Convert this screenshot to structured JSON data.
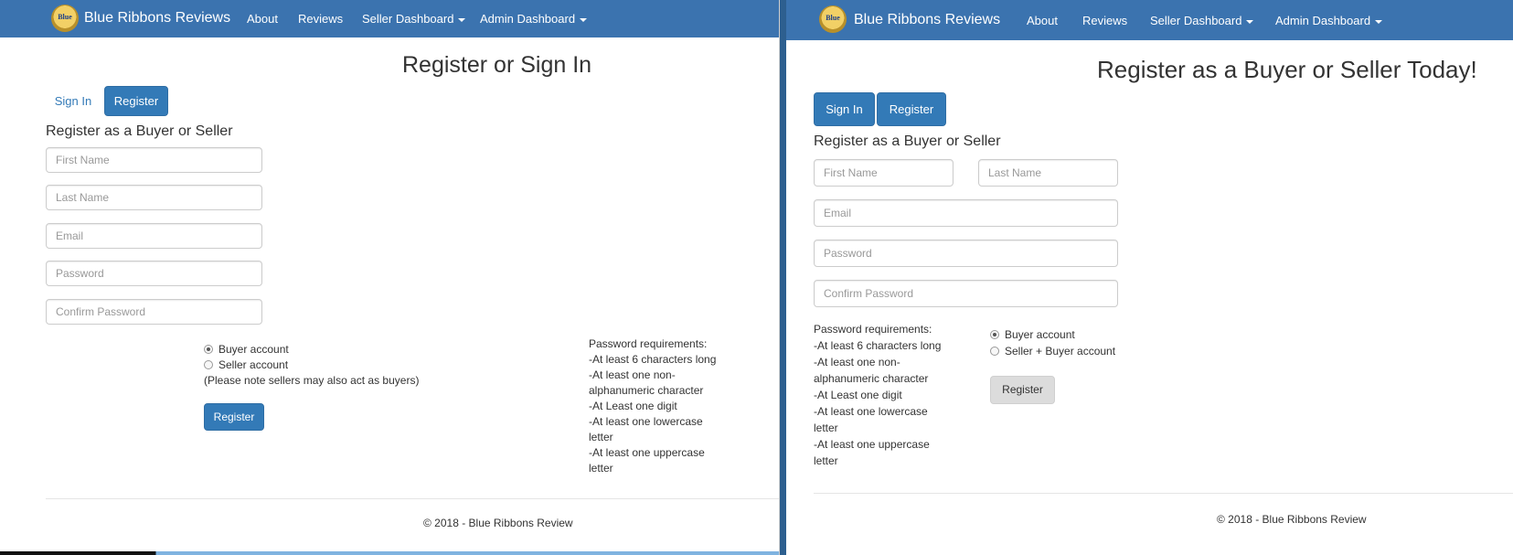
{
  "left": {
    "navbar": {
      "brand": "Blue Ribbons Reviews",
      "logo_text": "Blue",
      "items": [
        "About",
        "Reviews",
        "Seller Dashboard",
        "Admin Dashboard"
      ]
    },
    "title": "Register or Sign In",
    "tabs": {
      "signin": "Sign In",
      "register": "Register"
    },
    "form_title": "Register as a Buyer or Seller",
    "placeholders": {
      "first_name": "First Name",
      "last_name": "Last Name",
      "email": "Email",
      "password": "Password",
      "confirm_password": "Confirm Password"
    },
    "account_types": {
      "buyer": "Buyer account",
      "seller": "Seller account"
    },
    "seller_note": "(Please note sellers may also act as buyers)",
    "register_button": "Register",
    "requirements": [
      "Password requirements:",
      "-At least 6 characters long",
      "-At least one non-",
      "alphanumeric character",
      "-At Least one digit",
      "-At least one lowercase",
      "letter",
      "-At least one uppercase",
      "letter"
    ],
    "footer": "© 2018 - Blue Ribbons Review"
  },
  "right": {
    "navbar": {
      "brand": "Blue Ribbons Reviews",
      "logo_text": "Blue",
      "items": [
        "About",
        "Reviews",
        "Seller Dashboard",
        "Admin Dashboard"
      ]
    },
    "title": "Register as a Buyer or Seller Today!",
    "tabs": {
      "signin": "Sign In",
      "register": "Register"
    },
    "form_title": "Register as a Buyer or Seller",
    "placeholders": {
      "first_name": "First Name",
      "last_name": "Last Name",
      "email": "Email",
      "password": "Password",
      "confirm_password": "Confirm Password"
    },
    "requirements": [
      "Password requirements:",
      "-At least 6 characters long",
      "-At least one non-",
      "alphanumeric character",
      "-At Least one digit",
      "-At least one lowercase",
      "letter",
      "-At least one uppercase",
      "letter"
    ],
    "account_types": {
      "buyer": "Buyer account",
      "seller": "Seller + Buyer account"
    },
    "register_button": "Register",
    "footer": "© 2018 - Blue Ribbons Review"
  }
}
